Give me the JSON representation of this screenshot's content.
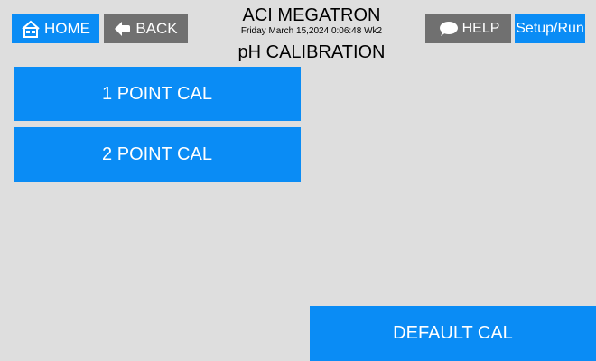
{
  "header": {
    "title": "ACI MEGATRON",
    "datetime": "Friday March 15,2024 0:06:48 Wk2",
    "subtitle": "pH CALIBRATION"
  },
  "nav": {
    "home_label": "HOME",
    "back_label": "BACK",
    "help_label": "HELP",
    "setup_label": "Setup/Run"
  },
  "actions": {
    "one_point_label": "1 POINT CAL",
    "two_point_label": "2 POINT CAL",
    "default_label": "DEFAULT CAL"
  },
  "icons": {
    "home": "house-icon",
    "back": "back-arrow-icon",
    "help": "speech-bubble-icon"
  },
  "colors": {
    "primary_button": "#0a8cf5",
    "secondary_button": "#707070",
    "background": "#dedede"
  }
}
